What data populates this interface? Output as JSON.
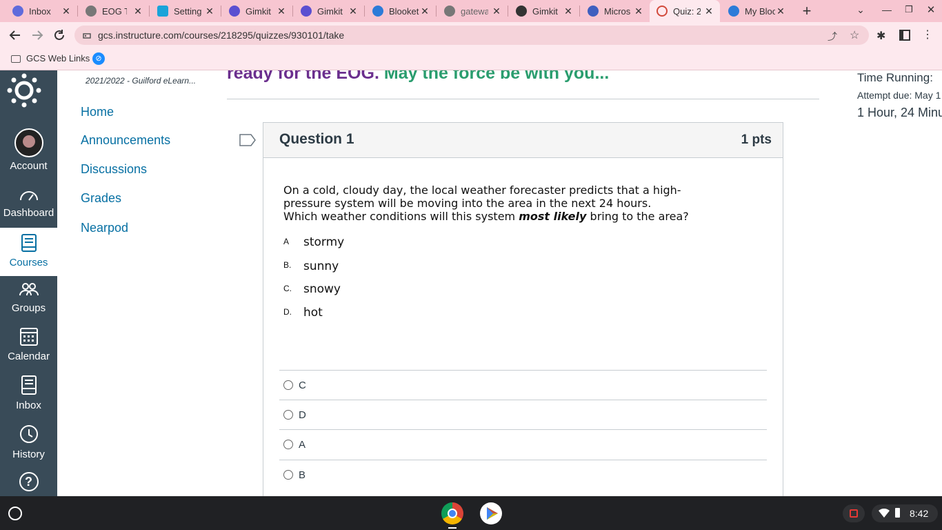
{
  "browser": {
    "tabs": [
      {
        "title": "Inbox",
        "color": "#5f6bdc"
      },
      {
        "title": "EOG Te",
        "color": "#777777"
      },
      {
        "title": "Setting",
        "color": "#1aa3d9"
      },
      {
        "title": "Gimkit",
        "color": "#5a4fd1"
      },
      {
        "title": "Gimkit",
        "color": "#5a4fd1"
      },
      {
        "title": "Blooket",
        "color": "#2d7bd8"
      },
      {
        "title": "gatewa",
        "color": "#777777"
      },
      {
        "title": "Gimkit",
        "color": "#333333"
      },
      {
        "title": "Micros",
        "color": "#3f5fbf"
      },
      {
        "title": "Quiz: 2",
        "color": "#d24a3b"
      },
      {
        "title": "My Bloo",
        "color": "#2d7bd8"
      }
    ],
    "url": "gcs.instructure.com/courses/218295/quizzes/930101/take",
    "bookmark": "GCS Web Links"
  },
  "course": {
    "term": "2021/2022 - Guilford eLearn...",
    "banner_part1": "ready for the EOG.",
    "banner_part2": "May the force be with you..."
  },
  "global_nav": [
    {
      "label": "Account",
      "icon": "avatar"
    },
    {
      "label": "Dashboard",
      "icon": "dashboard-icon"
    },
    {
      "label": "Courses",
      "icon": "courses-icon"
    },
    {
      "label": "Groups",
      "icon": "groups-icon"
    },
    {
      "label": "Calendar",
      "icon": "calendar-icon"
    },
    {
      "label": "Inbox",
      "icon": "inbox-icon"
    },
    {
      "label": "History",
      "icon": "history-icon"
    },
    {
      "label": "?",
      "icon": "help-icon"
    }
  ],
  "course_nav": [
    "Home",
    "Announcements",
    "Discussions",
    "Grades",
    "Nearpod"
  ],
  "sidebar": {
    "time_running": "Time Running:",
    "attempt_due": "Attempt due: May 1",
    "timer": "1 Hour, 24 Minu"
  },
  "question": {
    "title": "Question 1",
    "points": "1 pts",
    "stem_line1": "On a cold, cloudy day, the local weather forecaster predicts that a high-",
    "stem_line2": "pressure system will be moving into the area in the next 24 hours.",
    "stem_line3_pre": "Which weather conditions will this system",
    "stem_emphasis": "most likely",
    "stem_line3_post": "bring to the area?",
    "choices": [
      {
        "letter": "A",
        "text": "stormy"
      },
      {
        "letter": "B.",
        "text": "sunny"
      },
      {
        "letter": "C.",
        "text": "snowy"
      },
      {
        "letter": "D.",
        "text": "hot"
      }
    ],
    "answers": [
      "C",
      "D",
      "A",
      "B"
    ]
  },
  "taskbar": {
    "time": "8:42"
  },
  "colors": {
    "canvas_nav": "#394b58",
    "link": "#0770a3",
    "banner_purple": "#6b2f8e",
    "banner_green": "#2a9d6e",
    "tabstrip": "#f7c6d1"
  }
}
